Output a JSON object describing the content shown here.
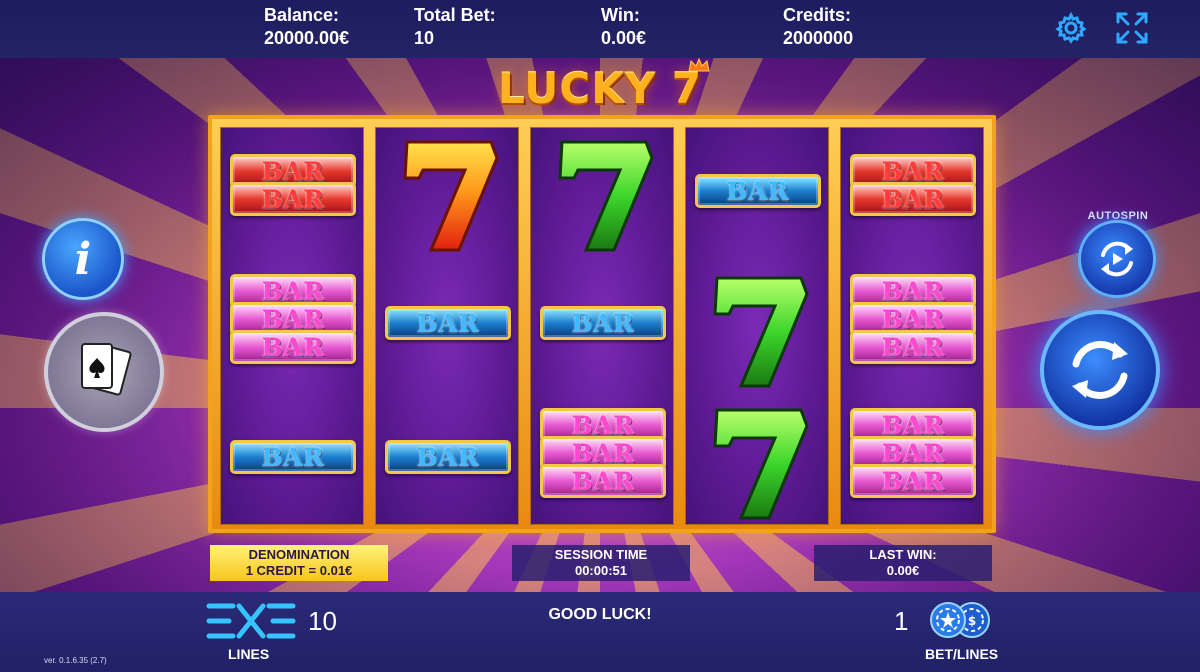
{
  "header": {
    "balance_label": "Balance:",
    "balance_value": "20000.00€",
    "total_bet_label": "Total Bet:",
    "total_bet_value": "10",
    "win_label": "Win:",
    "win_value": "0.00€",
    "credits_label": "Credits:",
    "credits_value": "2000000",
    "settings_icon": "gear-icon",
    "fullscreen_icon": "expand-arrows-icon"
  },
  "game": {
    "title": "LUCKY 7"
  },
  "reels": [
    [
      "BAR",
      "BAR",
      "BAR",
      "BAR",
      "BAR",
      "BAR"
    ],
    [
      "7",
      "BAR",
      "BAR"
    ],
    [
      "7",
      "BAR",
      "BAR",
      "BAR",
      "BAR"
    ],
    [
      "BAR",
      "7",
      "7"
    ],
    [
      "BAR",
      "BAR",
      "BAR",
      "BAR",
      "BAR",
      "BAR",
      "BAR",
      "BAR"
    ]
  ],
  "panels": {
    "denomination_label": "DENOMINATION",
    "denomination_value": "1 CREDIT = 0.01€",
    "session_label": "SESSION TIME",
    "session_value": "00:00:51",
    "last_win_label": "LAST WIN:",
    "last_win_value": "0.00€"
  },
  "controls": {
    "info_glyph": "i",
    "autospin_label": "AUTOSPIN"
  },
  "footer": {
    "lines_value": "10",
    "lines_label": "LINES",
    "message": "GOOD LUCK!",
    "bet_lines_value": "1",
    "bet_lines_label": "BET/LINES",
    "version": "ver. 0.1.6.35 (2.7)"
  },
  "colors": {
    "accent_gold": "#f3a21e",
    "button_blue": "#1b56c9",
    "bar_red": "#e63a2e",
    "bar_pink": "#e85ad2",
    "bar_blue": "#1d7fcf",
    "seven_red_orange": "#ff5a10",
    "seven_green": "#3cd62a"
  }
}
